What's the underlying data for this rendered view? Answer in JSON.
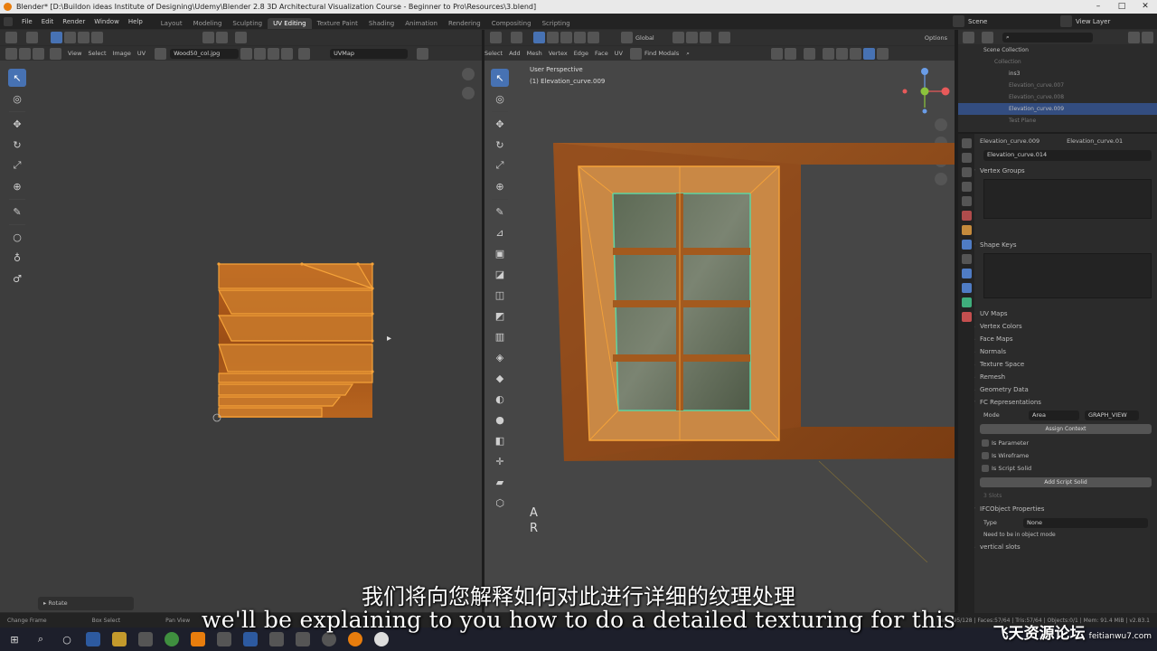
{
  "window": {
    "title": "Blender* [D:\\Buildon ideas Institute of Designing\\Udemy\\Blender 2.8 3D Architectural Visualization Course - Beginner to Pro\\Resources\\3.blend]",
    "controls": [
      "–",
      "□",
      "✕"
    ]
  },
  "menubar": {
    "menus": [
      "File",
      "Edit",
      "Render",
      "Window",
      "Help"
    ],
    "workspace_tabs": [
      "Layout",
      "Modeling",
      "Sculpting",
      "UV Editing",
      "Texture Paint",
      "Shading",
      "Animation",
      "Rendering",
      "Compositing",
      "Scripting"
    ],
    "active_workspace": "UV Editing",
    "scene_label": "Scene",
    "view_layer_label": "View Layer"
  },
  "uv_editor": {
    "header_menus": [
      "View",
      "Select",
      "Image",
      "UV"
    ],
    "image_name": "Wood50_col.jpg",
    "uvmap_name": "UVMap",
    "last_op_label": "Rotate"
  },
  "viewport": {
    "header_menus": [
      "Select",
      "Add",
      "Mesh",
      "Vertex",
      "Edge",
      "Face",
      "UV"
    ],
    "find_modals": "Find Modals",
    "orientation": "Global",
    "options_label": "Options",
    "view_name": "User Perspective",
    "object_info": "(1) Elevation_curve.009",
    "overlay_keys": [
      "A",
      "R"
    ]
  },
  "outliner": {
    "rows": [
      {
        "label": "Scene Collection",
        "dim": false
      },
      {
        "label": "Collection",
        "dim": true
      },
      {
        "label": "ins3",
        "dim": false
      },
      {
        "label": "Elevation_curve.007",
        "dim": true
      },
      {
        "label": "Elevation_curve.008",
        "dim": true
      },
      {
        "label": "Elevation_curve.009",
        "dim": false
      },
      {
        "label": "Test Plane",
        "dim": true
      }
    ]
  },
  "properties": {
    "object_name": "Elevation_curve.009",
    "object_name_right": "Elevation_curve.01",
    "mesh_name": "Elevation_curve.014",
    "panels_open": [
      "Vertex Groups",
      "Shape Keys"
    ],
    "panels": [
      "UV Maps",
      "Vertex Colors",
      "Face Maps",
      "Normals",
      "Texture Space",
      "Remesh",
      "Geometry Data",
      "FC Representations"
    ],
    "fc_mode_label": "Mode",
    "fc_mode_value": "Area",
    "fc_mode_value2": "GRAPH_VIEW",
    "assign_button": "Assign Context",
    "checkboxes": [
      "Is Parameter",
      "Is Wireframe",
      "Is Script Solid"
    ],
    "add_button": "Add Script Solid",
    "dim_label": "3 Slots",
    "ifc_panel": "IFCObject Properties",
    "type_label": "Type",
    "type_value": "None",
    "note": "Need to be in object mode",
    "last_panel": "vertical slots"
  },
  "statusbar": {
    "items": [
      "Change Frame",
      "Box Select",
      "Pan View"
    ],
    "right_text": "Verts:95/128 | Faces:57/64 | Tris:57/64 | Objects:0/1 | Mem: 91.4 MiB | v2.83.1"
  },
  "subtitles": {
    "chinese": "我们将向您解释如何对此进行详细的纹理处理",
    "english": "we'll be explaining to you how to do a detailed texturing for this"
  },
  "watermark": {
    "text": "飞天资源论坛",
    "url": "feitianwu7.com"
  },
  "colors": {
    "wood": "#a0521a",
    "selection": "#f5a33a",
    "glass_edge": "#5fd3a0",
    "accent": "#4772b3"
  }
}
